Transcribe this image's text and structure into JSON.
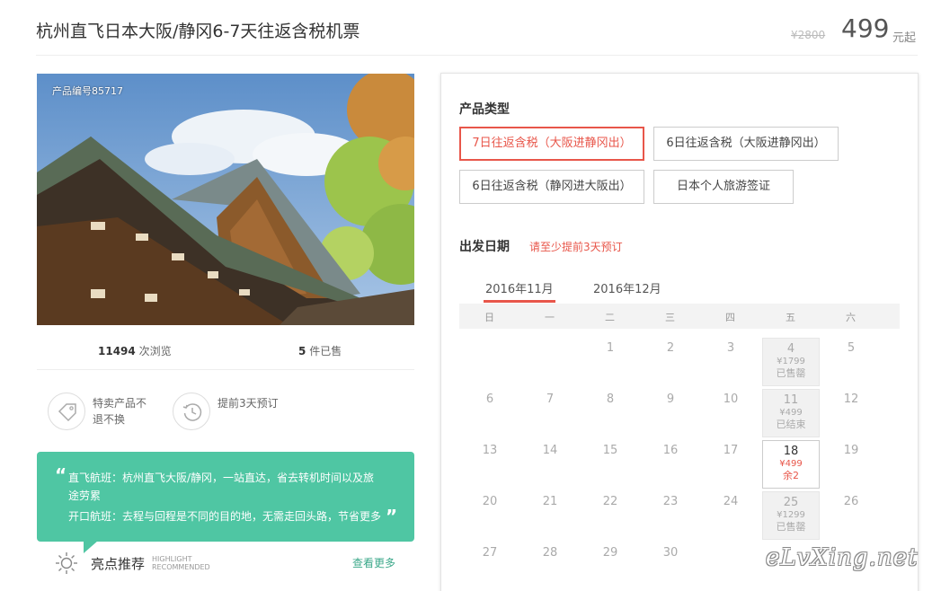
{
  "header": {
    "title": "杭州直飞日本大阪/静冈6-7天往返含税机票",
    "price_old": "¥2800",
    "price": "499",
    "price_suffix": "元起"
  },
  "product": {
    "code": "产品编号85717",
    "views_count": "11494",
    "views_label": "次浏览",
    "sold_count": "5",
    "sold_label": "件已售"
  },
  "features": [
    {
      "icon": "tag-icon",
      "text": "特卖产品不退不换"
    },
    {
      "icon": "clock-history-icon",
      "text": "提前3天预订"
    }
  ],
  "highlight": {
    "line1": "直飞航班：杭州直飞大阪/静冈，一站直达，省去转机时间以及旅",
    "line2": "途劳累",
    "line3": "开口航班：去程与回程是不同的目的地，无需走回头路，节省更多",
    "title": "亮点推荐",
    "sub1": "HIGHLIGHT",
    "sub2": "RECOMMENDED",
    "more": "查看更多"
  },
  "panel": {
    "type_label": "产品类型",
    "options": [
      "7日往返含税（大阪进静冈出）",
      "6日往返含税（大阪进静冈出）",
      "6日往返含税（静冈进大阪出）",
      "日本个人旅游签证"
    ],
    "selected_option": 0,
    "date_label": "出发日期",
    "date_note": "请至少提前3天预订",
    "months": [
      "2016年11月",
      "2016年12月"
    ],
    "weekdays": [
      "日",
      "一",
      "二",
      "三",
      "四",
      "五",
      "六"
    ],
    "days": [
      {
        "d": "1",
        "col": 2,
        "row": 0
      },
      {
        "d": "2",
        "col": 3,
        "row": 0
      },
      {
        "d": "3",
        "col": 4,
        "row": 0
      },
      {
        "d": "4",
        "col": 5,
        "row": 0,
        "price": "¥1799",
        "status": "已售罄",
        "kind": "off"
      },
      {
        "d": "5",
        "col": 6,
        "row": 0
      },
      {
        "d": "6",
        "col": 0,
        "row": 1
      },
      {
        "d": "7",
        "col": 1,
        "row": 1
      },
      {
        "d": "8",
        "col": 2,
        "row": 1
      },
      {
        "d": "9",
        "col": 3,
        "row": 1
      },
      {
        "d": "10",
        "col": 4,
        "row": 1
      },
      {
        "d": "11",
        "col": 5,
        "row": 1,
        "price": "¥499",
        "status": "已结束",
        "kind": "off"
      },
      {
        "d": "12",
        "col": 6,
        "row": 1
      },
      {
        "d": "13",
        "col": 0,
        "row": 2
      },
      {
        "d": "14",
        "col": 1,
        "row": 2
      },
      {
        "d": "15",
        "col": 2,
        "row": 2
      },
      {
        "d": "16",
        "col": 3,
        "row": 2
      },
      {
        "d": "17",
        "col": 4,
        "row": 2
      },
      {
        "d": "18",
        "col": 5,
        "row": 2,
        "price": "¥499",
        "status": "余2",
        "kind": "avail"
      },
      {
        "d": "19",
        "col": 6,
        "row": 2
      },
      {
        "d": "20",
        "col": 0,
        "row": 3
      },
      {
        "d": "21",
        "col": 1,
        "row": 3
      },
      {
        "d": "22",
        "col": 2,
        "row": 3
      },
      {
        "d": "23",
        "col": 3,
        "row": 3
      },
      {
        "d": "24",
        "col": 4,
        "row": 3
      },
      {
        "d": "25",
        "col": 5,
        "row": 3,
        "price": "¥1299",
        "status": "已售罄",
        "kind": "off"
      },
      {
        "d": "26",
        "col": 6,
        "row": 3
      },
      {
        "d": "27",
        "col": 0,
        "row": 4
      },
      {
        "d": "28",
        "col": 1,
        "row": 4
      },
      {
        "d": "29",
        "col": 2,
        "row": 4
      },
      {
        "d": "30",
        "col": 3,
        "row": 4
      }
    ]
  },
  "watermark": "eLvXing.net"
}
